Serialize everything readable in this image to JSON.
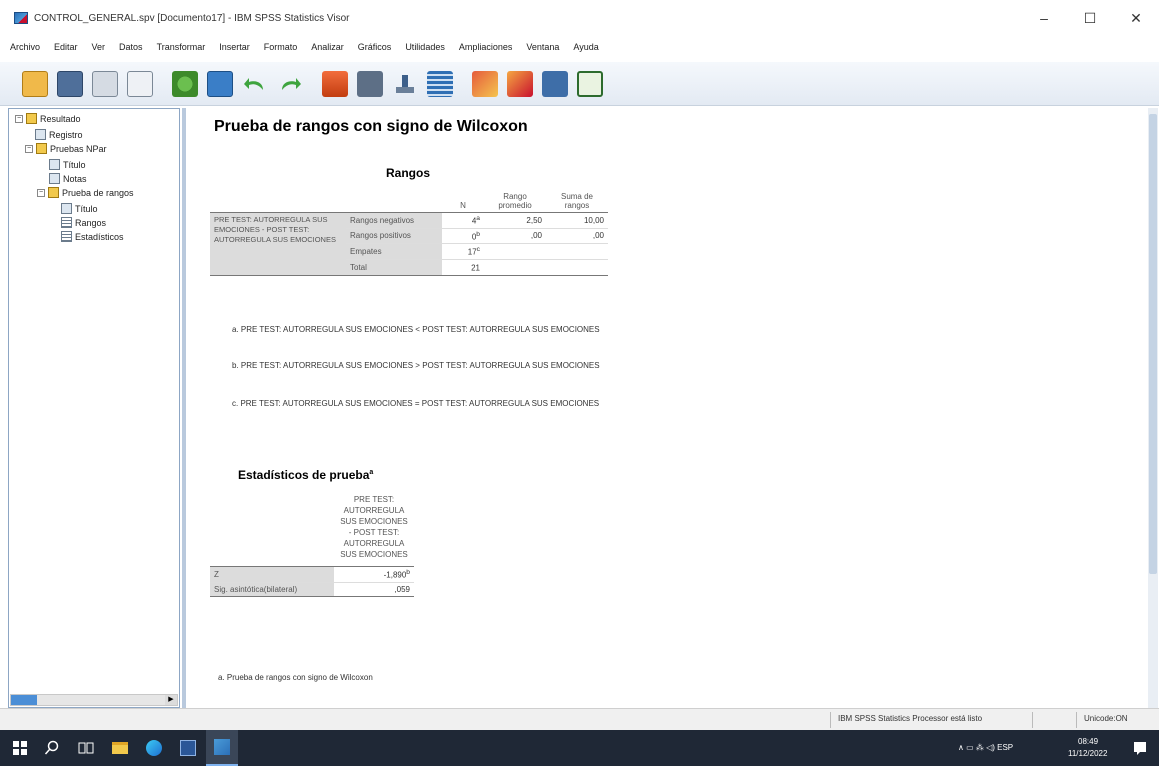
{
  "window": {
    "title": "CONTROL_GENERAL.spv [Documento17] - IBM SPSS Statistics Visor",
    "minimize": "–",
    "maximize": "☐",
    "close": "✕"
  },
  "menu": [
    "Archivo",
    "Editar",
    "Ver",
    "Datos",
    "Transformar",
    "Insertar",
    "Formato",
    "Analizar",
    "Gráficos",
    "Utilidades",
    "Ampliaciones",
    "Ventana",
    "Ayuda"
  ],
  "toolbar_icons": [
    "open-icon",
    "save-icon",
    "print-icon",
    "print-preview-icon",
    "export-icon",
    "dialog-recall-icon",
    "undo-icon",
    "redo-icon",
    "goto-data-icon",
    "goto-case-icon",
    "variables-icon",
    "chart-icon",
    "insert-output-icon",
    "insert-text-icon",
    "show-all-icon",
    "designate-window-icon"
  ],
  "tree": {
    "root": "Resultado",
    "log": "Registro",
    "group": "Pruebas NPar",
    "title": "Título",
    "notes": "Notas",
    "test": "Prueba de rangos",
    "sub_title": "Título",
    "ranks": "Rangos",
    "stats": "Estadísticos"
  },
  "output": {
    "heading": "Prueba de rangos con signo de Wilcoxon",
    "ranks_table": {
      "title": "Rangos",
      "col_n": "N",
      "col_mean": "Rango promedio",
      "col_sum": "Suma de rangos",
      "var_label": "PRE TEST: AUTORREGULA SUS EMOCIONES - POST TEST: AUTORREGULA SUS EMOCIONES",
      "rows": [
        {
          "label": "Rangos negativos",
          "n": "4",
          "sup": "a",
          "mean": "2,50",
          "sum": "10,00"
        },
        {
          "label": "Rangos positivos",
          "n": "0",
          "sup": "b",
          "mean": ",00",
          "sum": ",00"
        },
        {
          "label": "Empates",
          "n": "17",
          "sup": "c",
          "mean": "",
          "sum": ""
        },
        {
          "label": "Total",
          "n": "21",
          "sup": "",
          "mean": "",
          "sum": ""
        }
      ],
      "footnotes": [
        "a. PRE TEST: AUTORREGULA SUS EMOCIONES < POST TEST: AUTORREGULA SUS EMOCIONES",
        "b. PRE TEST: AUTORREGULA SUS EMOCIONES > POST TEST: AUTORREGULA SUS EMOCIONES",
        "c. PRE TEST: AUTORREGULA SUS EMOCIONES = POST TEST: AUTORREGULA SUS EMOCIONES"
      ]
    },
    "stats_table": {
      "title": "Estadísticos de prueba",
      "title_sup": "a",
      "col_header": "PRE TEST: AUTORREGULA SUS EMOCIONES - POST TEST: AUTORREGULA SUS EMOCIONES",
      "rows": [
        {
          "label": "Z",
          "value": "-1,890",
          "sup": "b"
        },
        {
          "label": "Sig. asintótica(bilateral)",
          "value": ",059",
          "sup": ""
        }
      ],
      "footnote": "a. Prueba de rangos con signo de Wilcoxon"
    }
  },
  "status": {
    "processor": "IBM SPSS Statistics Processor está listo",
    "unicode": "Unicode:ON"
  },
  "taskbar": {
    "tray": "∧ ▭ ⁂ ◁) ESP",
    "time": "08:49",
    "date": "11/12/2022"
  },
  "colors": {
    "toolbar_bg": "#e3eaf3",
    "pane_border": "#8da6c4",
    "table_gray": "#dcdcdc",
    "taskbar_bg": "#1f2836"
  }
}
